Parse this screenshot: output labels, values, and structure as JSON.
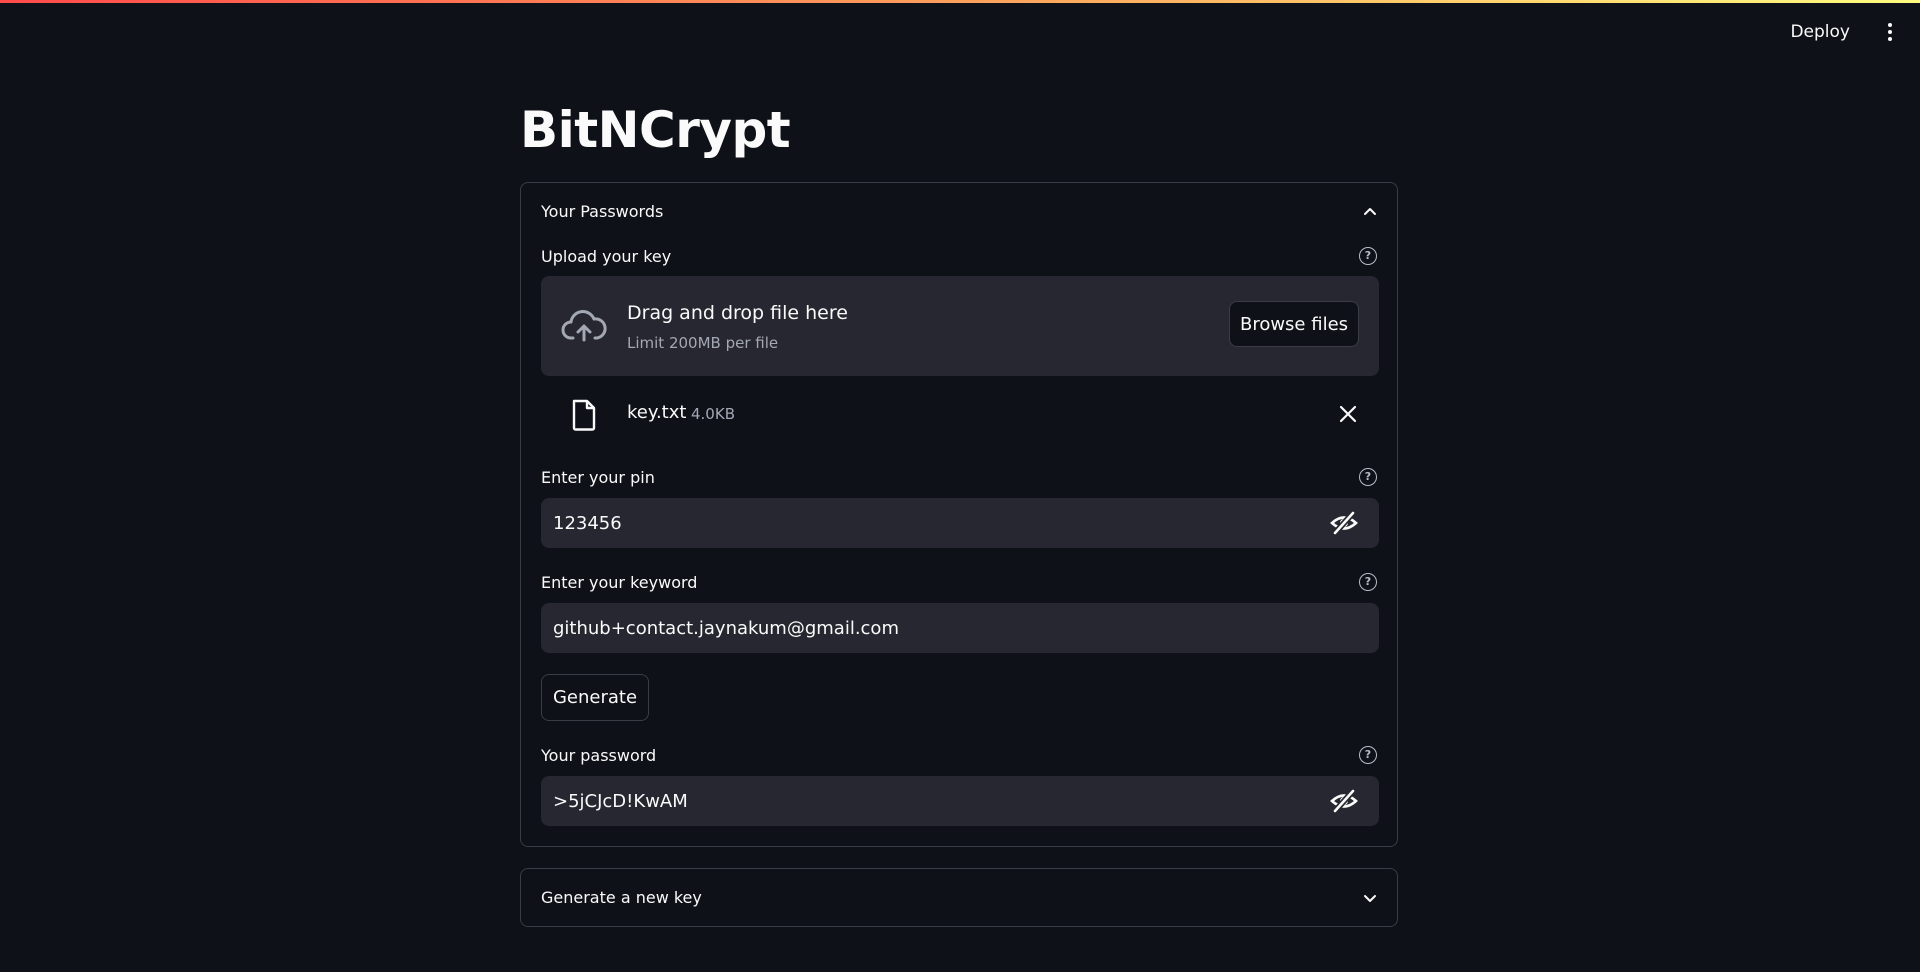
{
  "header": {
    "deploy_label": "Deploy",
    "menu_icon": "kebab-menu-icon"
  },
  "page": {
    "title": "BitNCrypt"
  },
  "expander_passwords": {
    "label": "Your Passwords",
    "expanded": true,
    "upload": {
      "label": "Upload your key",
      "drop_title": "Drag and drop file here",
      "drop_subtitle": "Limit 200MB per file",
      "browse_label": "Browse files",
      "file": {
        "name": "key.txt",
        "size": "4.0KB"
      }
    },
    "pin": {
      "label": "Enter your pin",
      "value": "123456"
    },
    "keyword": {
      "label": "Enter your keyword",
      "value": "github+contact.jaynakum@gmail.com"
    },
    "generate_label": "Generate",
    "password": {
      "label": "Your password",
      "value": ">5jCJcD!KwAM"
    }
  },
  "expander_new_key": {
    "label": "Generate a new key",
    "expanded": false
  },
  "colors": {
    "background": "#0e1117",
    "input_bg": "#262730",
    "border": "#3a3d45",
    "text": "#fafafa"
  }
}
